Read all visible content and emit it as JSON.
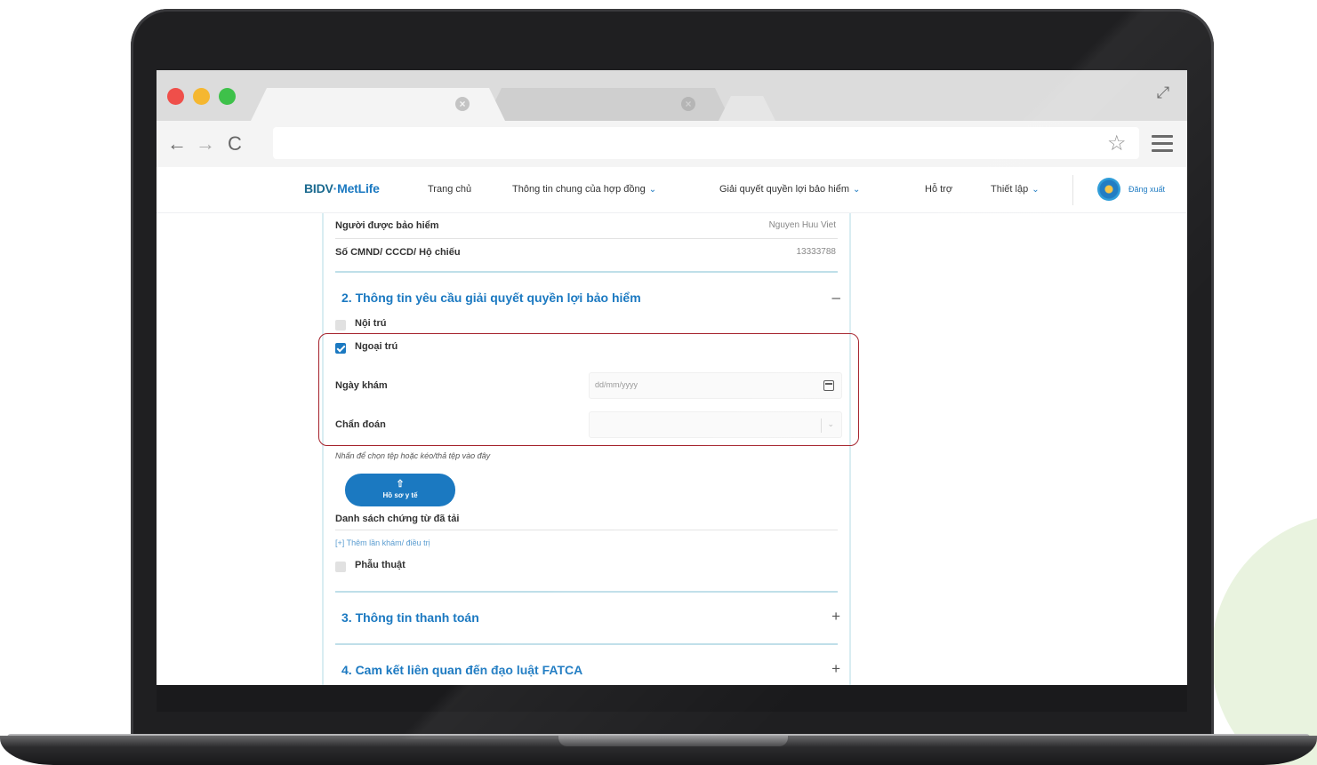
{
  "browser": {
    "tabs": [
      {
        "label": "",
        "close_glyph": "×"
      },
      {
        "label": "",
        "close_glyph": "×"
      }
    ],
    "back_glyph": "←",
    "forward_glyph": "→",
    "reload_glyph": "C",
    "star_glyph": "☆",
    "expand_glyph": "⤢",
    "url": ""
  },
  "sitenav": {
    "logo_part1": "BIDV",
    "logo_part2": "·MetLife",
    "items": [
      {
        "label": "Trang chủ",
        "has_dropdown": false
      },
      {
        "label": "Thông tin chung của hợp đồng",
        "has_dropdown": true
      },
      {
        "label": "Giải quyết quyền lợi bảo hiểm",
        "has_dropdown": true
      },
      {
        "label": "Hỗ trợ",
        "has_dropdown": false
      },
      {
        "label": "Thiết lập",
        "has_dropdown": true
      }
    ],
    "dropdown_glyph": "⌄",
    "logout_label": "Đăng xuất"
  },
  "insured": {
    "name_label": "Người được bảo hiểm",
    "name_value": "Nguyen Huu Viet",
    "id_label": "Số CMND/ CCCD/ Hộ chiếu",
    "id_value": "13333788"
  },
  "section2": {
    "title": "2. Thông tin yêu cầu giải quyết quyền lợi bảo hiểm",
    "toggle": "–",
    "inpatient_label": "Nội trú",
    "inpatient_checked": false,
    "outpatient_label": "Ngoại trú",
    "outpatient_checked": true,
    "exam_date_label": "Ngày khám",
    "exam_date_placeholder": "dd/mm/yyyy",
    "diagnosis_label": "Chẩn đoán",
    "diagnosis_arrow": "⌄",
    "upload_hint": "Nhấn để chọn tệp hoặc kéo/thả tệp vào đây",
    "upload_icon": "⇧",
    "upload_button_label": "Hồ sơ y tế",
    "uploaded_list_label": "Danh sách chứng từ đã tải",
    "add_visit_link": "[+] Thêm lần khám/ điều trị",
    "surgery_label": "Phẫu thuật",
    "surgery_checked": false
  },
  "section3": {
    "title": "3. Thông tin thanh toán",
    "toggle": "+"
  },
  "section4": {
    "title": "4. Cam kết liên quan đến đạo luật FATCA",
    "toggle": "+"
  },
  "colors": {
    "brand_blue": "#1b79c1",
    "highlight_red": "#a4202a",
    "accent_green_circle": "#e9f3df"
  }
}
